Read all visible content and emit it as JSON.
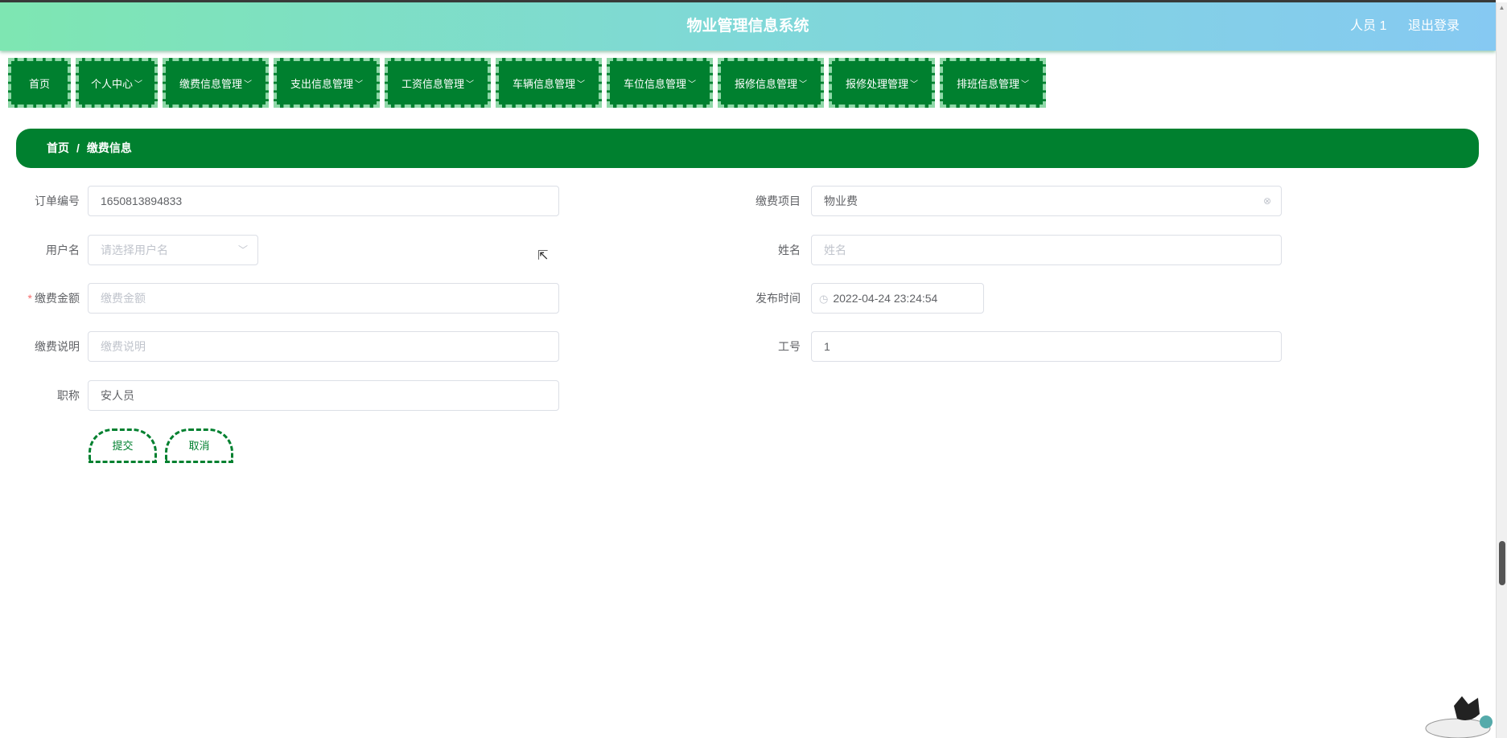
{
  "header": {
    "title": "物业管理信息系统",
    "user": "人员 1",
    "logout": "退出登录"
  },
  "nav": [
    {
      "label": "首页",
      "dropdown": false
    },
    {
      "label": "个人中心",
      "dropdown": true
    },
    {
      "label": "缴费信息管理",
      "dropdown": true
    },
    {
      "label": "支出信息管理",
      "dropdown": true
    },
    {
      "label": "工资信息管理",
      "dropdown": true
    },
    {
      "label": "车辆信息管理",
      "dropdown": true
    },
    {
      "label": "车位信息管理",
      "dropdown": true
    },
    {
      "label": "报修信息管理",
      "dropdown": true
    },
    {
      "label": "报修处理管理",
      "dropdown": true
    },
    {
      "label": "排班信息管理",
      "dropdown": true
    }
  ],
  "breadcrumb": {
    "home": "首页",
    "separator": "/",
    "current": "缴费信息"
  },
  "form": {
    "order_no": {
      "label": "订单编号",
      "value": "1650813894833"
    },
    "item": {
      "label": "缴费项目",
      "value": "物业费"
    },
    "username": {
      "label": "用户名",
      "placeholder": "请选择用户名"
    },
    "name": {
      "label": "姓名",
      "placeholder": "姓名"
    },
    "amount": {
      "label": "缴费金额",
      "placeholder": "缴费金额",
      "required": "*"
    },
    "publish_time": {
      "label": "发布时间",
      "value": "2022-04-24 23:24:54"
    },
    "description": {
      "label": "缴费说明",
      "placeholder": "缴费说明"
    },
    "job_no": {
      "label": "工号",
      "value": "1"
    },
    "title": {
      "label": "职称",
      "value": "安人员"
    },
    "submit": "提交",
    "cancel": "取消"
  },
  "colors": {
    "primary": "#00802f",
    "header_start": "#7ee6b2",
    "header_end": "#86c9f2"
  }
}
